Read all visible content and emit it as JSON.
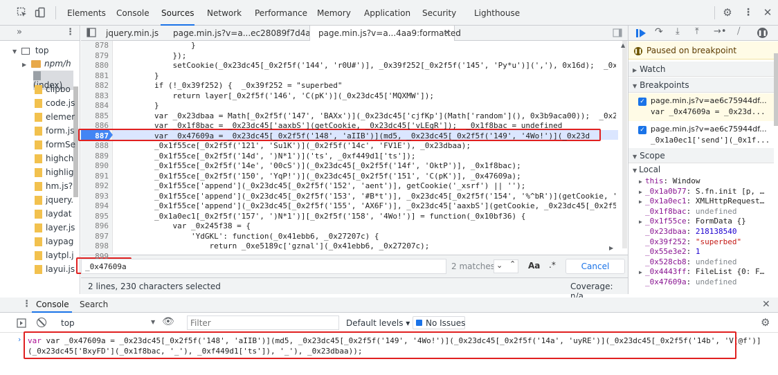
{
  "main_tabs": [
    "Elements",
    "Console",
    "Sources",
    "Network",
    "Performance",
    "Memory",
    "Application",
    "Security",
    "Lighthouse"
  ],
  "active_tab": "Sources",
  "navigator": {
    "top_label": "top",
    "folder_label": "npm/h",
    "items": [
      "(index)",
      "clipbo",
      "code.js",
      "elemer",
      "form.js",
      "formSe",
      "highch",
      "highlig",
      "hm.js?",
      "jquery.",
      "laydat",
      "layer.js",
      "laypag",
      "laytpl.j",
      "layui.js"
    ]
  },
  "editor_tabs": [
    "jquery.min.js",
    "page.min.js?v=a...ec28089f7d4aa9",
    "page.min.js?v=a...4aa9:formatted"
  ],
  "lines": [
    {
      "n": "878",
      "t": "                }"
    },
    {
      "n": "879",
      "t": "            });"
    },
    {
      "n": "880",
      "t": "            setCookie(_0x23dc45[_0x2f5f('144', 'r0U#')], _0x39f252[_0x2f5f('145', 'Py*u')](','), 0x16d);  _0x3"
    },
    {
      "n": "881",
      "t": "        }"
    },
    {
      "n": "882",
      "t": "        if (!_0x39f252) {  _0x39f252 = \"superbed\""
    },
    {
      "n": "883",
      "t": "            return layer[_0x2f5f('146', 'C(pK')](_0x23dc45['MQXMW']);"
    },
    {
      "n": "884",
      "t": "        }"
    },
    {
      "n": "885",
      "t": "        var _0x23dbaa = Math[_0x2f5f('147', 'BAXx')](_0x23dc45['cjfKp'](Math['random'](), 0x3b9aca00));  _0x23"
    },
    {
      "n": "886",
      "t": "        var _0x1f8bac = _0x23dc45['aaxbS'](getCookie, _0x23dc45['vLEgR']);  _0x1f8bac = undefined"
    },
    {
      "n": "887",
      "t": "        var _0x47609a = _0x23dc45[_0x2f5f('148', 'aIIB')](md5, _0x23dc45[_0x2f5f('149', '4Wo!')](_0x23d"
    },
    {
      "n": "888",
      "t": "        _0x1f55ce[_0x2f5f('121', 'Su1K')](_0x2f5f('14c', 'FV1E'), _0x23dbaa);"
    },
    {
      "n": "889",
      "t": "        _0x1f55ce[_0x2f5f('14d', ')N*1')]('ts', _0xf449d1['ts']);"
    },
    {
      "n": "890",
      "t": "        _0x1f55ce[_0x2f5f('14e', '00cS')](_0x23dc45[_0x2f5f('14f', 'OktP')], _0x1f8bac);"
    },
    {
      "n": "891",
      "t": "        _0x1f55ce[_0x2f5f('150', 'YqP!')](_0x23dc45[_0x2f5f('151', 'C(pK')], _0x47609a);"
    },
    {
      "n": "892",
      "t": "        _0x1f55ce['append'](_0x23dc45[_0x2f5f('152', 'aent')], getCookie('_xsrf') || '');"
    },
    {
      "n": "893",
      "t": "        _0x1f55ce['append'](_0x23dc45[_0x2f5f('153', '#B*t')], _0x23dc45[_0x2f5f('154', '%^bR')](getCookie, 'e"
    },
    {
      "n": "894",
      "t": "        _0x1f55ce['append'](_0x23dc45[_0x2f5f('155', 'AX6F')], _0x23dc45['aaxbS'](getCookie, _0x23dc45[_0x2f5f"
    },
    {
      "n": "895",
      "t": "        _0x1a0ec1[_0x2f5f('157', ')N*1')][_0x2f5f('158', '4Wo!')] = function(_0x10bf36) {"
    },
    {
      "n": "896",
      "t": "            var _0x245f38 = {"
    },
    {
      "n": "897",
      "t": "                'YdGKL': function(_0x41ebb6, _0x27207c) {"
    },
    {
      "n": "898",
      "t": "                    return _0xe5189c['gznal'](_0x41ebb6, _0x27207c);"
    },
    {
      "n": "899",
      "t": ""
    }
  ],
  "search": {
    "value": "_0x47609a",
    "matches": "2 matches",
    "case_label": "Aa",
    "regex_label": ".*",
    "cancel_label": "Cancel"
  },
  "status": {
    "selection": "2 lines, 230 characters selected",
    "coverage": "Coverage: n/a"
  },
  "debugger": {
    "paused": "Paused on breakpoint",
    "watch": "Watch",
    "breakpoints": "Breakpoints",
    "bp_items": [
      {
        "file": "page.min.js?v=ae6c75944df...",
        "code": "var _0x47609a = _0x23d..."
      },
      {
        "file": "page.min.js?v=ae6c75944df...",
        "code": "_0x1a0ec1['send'](_0x1f..."
      }
    ],
    "scope": "Scope",
    "local": "Local",
    "vars": [
      {
        "name": "this",
        "val": "Window",
        "arrow": "▶"
      },
      {
        "name": "_0x1a0b77",
        "val": "S.fn.init [p, …",
        "arrow": "▶"
      },
      {
        "name": "_0x1a0ec1",
        "val": "XMLHttpRequest…",
        "arrow": "▶"
      },
      {
        "name": "_0x1f8bac",
        "val": "undefined",
        "arrow": ""
      },
      {
        "name": "_0x1f55ce",
        "val": "FormData {}",
        "arrow": "▶"
      },
      {
        "name": "_0x23dbaa",
        "val": "218138540",
        "arrow": ""
      },
      {
        "name": "_0x39f252",
        "val": "\"superbed\"",
        "arrow": ""
      },
      {
        "name": "_0x55e3e2",
        "val": "1",
        "arrow": ""
      },
      {
        "name": "_0x528cb8",
        "val": "undefined",
        "arrow": ""
      },
      {
        "name": "_0x4443ff",
        "val": "FileList {0: F…",
        "arrow": "▶"
      },
      {
        "name": "_0x47609a",
        "val": "undefined",
        "arrow": ""
      }
    ]
  },
  "console": {
    "tabs": [
      "Console",
      "Search"
    ],
    "context": "top",
    "filter_placeholder": "Filter",
    "levels": "Default levels ▾",
    "issues": "No Issues",
    "line1": "var _0x47609a = _0x23dc45[_0x2f5f('148', 'aIIB')](md5, _0x23dc45[_0x2f5f('149', '4Wo!')](_0x23dc45[_0x2f5f('14a', 'uyRE')](_0x23dc45[_0x2f5f('14b', 'V[@f')]",
    "line2": "(_0x23dc45['BxyFD'](_0x1f8bac, '_'), _0xf449d1['ts']), '_'), _0x23dbaa));"
  }
}
